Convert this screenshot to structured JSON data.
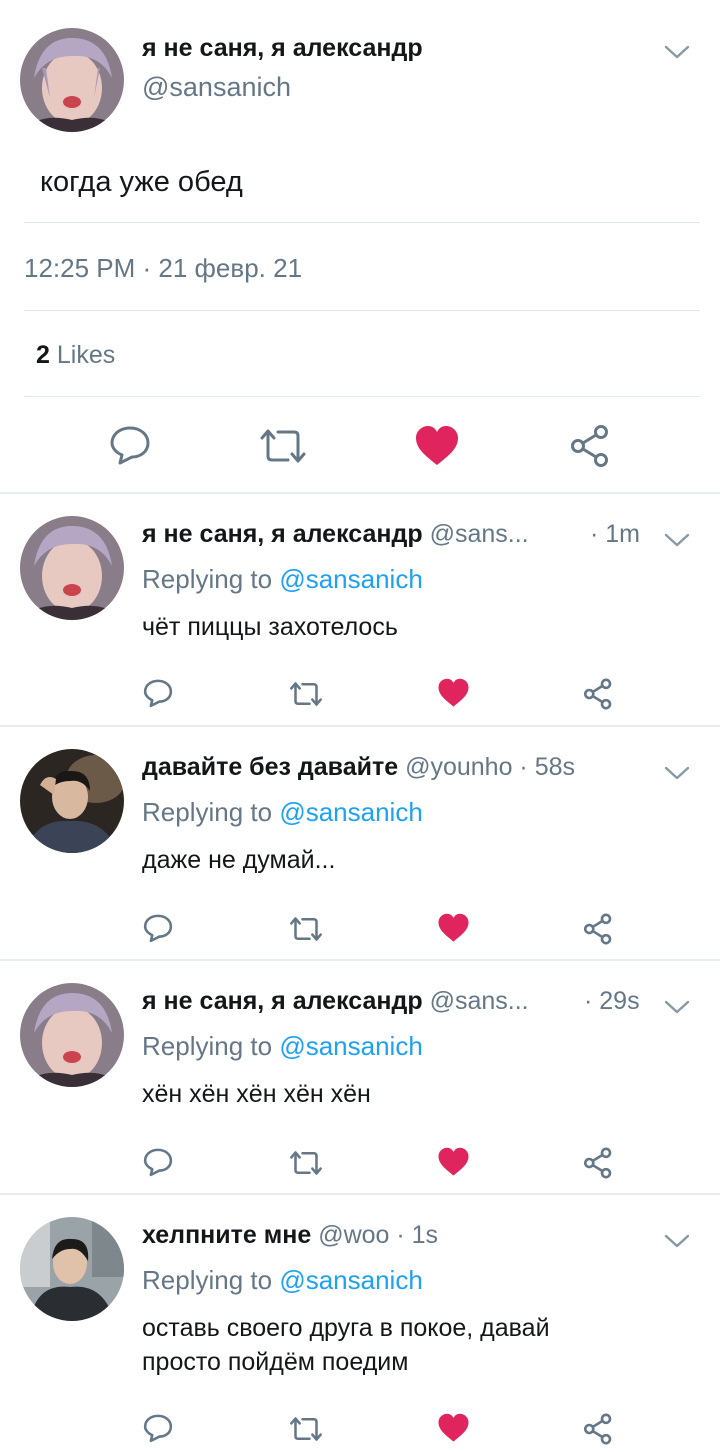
{
  "main_tweet": {
    "name": "я не саня, я александр",
    "handle": "@sansanich",
    "text": "когда уже обед",
    "timestamp": "12:25 PM · 21 февр. 21",
    "likes_count": "2",
    "likes_label": "Likes",
    "liked": true
  },
  "replies": [
    {
      "name": "я не саня, я александр",
      "handle": "@sans...",
      "time": "· 1m",
      "replying_prefix": "Replying to",
      "replying_to": "@sansanich",
      "text": "чёт пиццы захотелось"
    },
    {
      "name": "давайте без давайте",
      "handle": "@younho · 58s",
      "time": "",
      "replying_prefix": "Replying to",
      "replying_to": "@sansanich",
      "text": "даже не думай..."
    },
    {
      "name": "я не саня, я александр",
      "handle": "@sans...",
      "time": "· 29s",
      "replying_prefix": "Replying to",
      "replying_to": "@sansanich",
      "text": "хён хён хён хён хён"
    },
    {
      "name": "хелпните мне",
      "handle": "@woo · 1s",
      "time": "",
      "replying_prefix": "Replying to",
      "replying_to": "@sansanich",
      "text": "оставь своего друга в покое, давай просто пойдём поедим"
    }
  ],
  "colors": {
    "like_red": "#e0245e",
    "icon_gray": "#657786",
    "mention_blue": "#1da1f2",
    "divider": "#e1e8ed"
  },
  "icons": [
    "reply-icon",
    "retweet-icon",
    "heart-icon",
    "share-icon",
    "chevron-down-icon"
  ]
}
